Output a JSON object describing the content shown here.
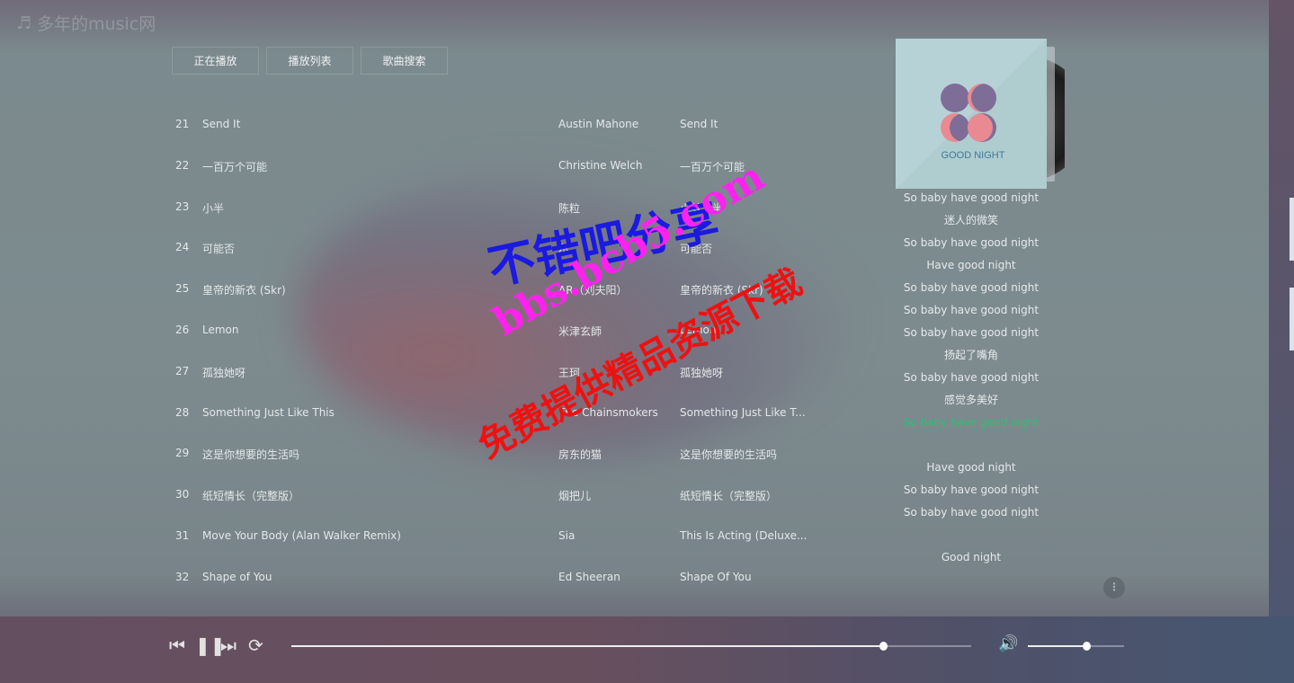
{
  "app": {
    "title": "多年的music网",
    "icon": "music-note-icon"
  },
  "tabs": [
    "正在播放",
    "播放列表",
    "歌曲搜索"
  ],
  "songs": [
    {
      "no": "21",
      "title": "Send It",
      "artist": "Austin Mahone",
      "album": "Send It"
    },
    {
      "no": "22",
      "title": "一百万个可能",
      "artist": "Christine Welch",
      "album": "一百万个可能"
    },
    {
      "no": "23",
      "title": "小半",
      "artist": "陈粒",
      "album": "小梦大半"
    },
    {
      "no": "24",
      "title": "可能否",
      "artist": "尔",
      "album": "可能否"
    },
    {
      "no": "25",
      "title": "皇帝的新衣 (Skr)",
      "artist": "AR（刘夫阳）",
      "album": "皇帝的新衣 (Skr)"
    },
    {
      "no": "26",
      "title": "Lemon",
      "artist": "米津玄師",
      "album": "Lemon"
    },
    {
      "no": "27",
      "title": "孤独她呀",
      "artist": "王珂",
      "album": "孤独她呀"
    },
    {
      "no": "28",
      "title": "Something Just Like This",
      "artist": "The Chainsmokers",
      "album": "Something Just Like T..."
    },
    {
      "no": "29",
      "title": "这是你想要的生活吗",
      "artist": "房东的猫",
      "album": "这是你想要的生活吗"
    },
    {
      "no": "30",
      "title": "纸短情长（完整版）",
      "artist": "烟把儿",
      "album": "纸短情长（完整版）"
    },
    {
      "no": "31",
      "title": "Move Your Body (Alan Walker Remix)",
      "artist": "Sia",
      "album": "This Is Acting (Deluxe..."
    },
    {
      "no": "32",
      "title": "Shape of You",
      "artist": "Ed Sheeran",
      "album": "Shape Of You"
    }
  ],
  "cover": {
    "text": "GOOD NIGHT"
  },
  "lyrics": [
    "So baby have good night",
    "迷人的微笑",
    "So baby have good night",
    "Have good night",
    "So baby have good night",
    "So baby have good night",
    "So baby have good night",
    "扬起了嘴角",
    "So baby have good night",
    "感觉多美好",
    "So baby have good night",
    "",
    "Have good night",
    "So baby have good night",
    "So baby have good night",
    "",
    "Good night"
  ],
  "current_lyric_index": 10,
  "colors": {
    "current_lyric": "#2fbe76",
    "wm1": "#1a1ae0",
    "wm2": "#ff22ee",
    "wm3": "#ee1111"
  },
  "player": {
    "progress_percent": 87,
    "volume_percent": 61,
    "icons": [
      "previous-icon",
      "pause-icon",
      "next-icon",
      "repeat-icon",
      "volume-icon"
    ]
  },
  "watermark": {
    "line1": "不错吧分享",
    "line2": "bbs.bcb5.com",
    "line3": "免费提供精品资源下载"
  }
}
